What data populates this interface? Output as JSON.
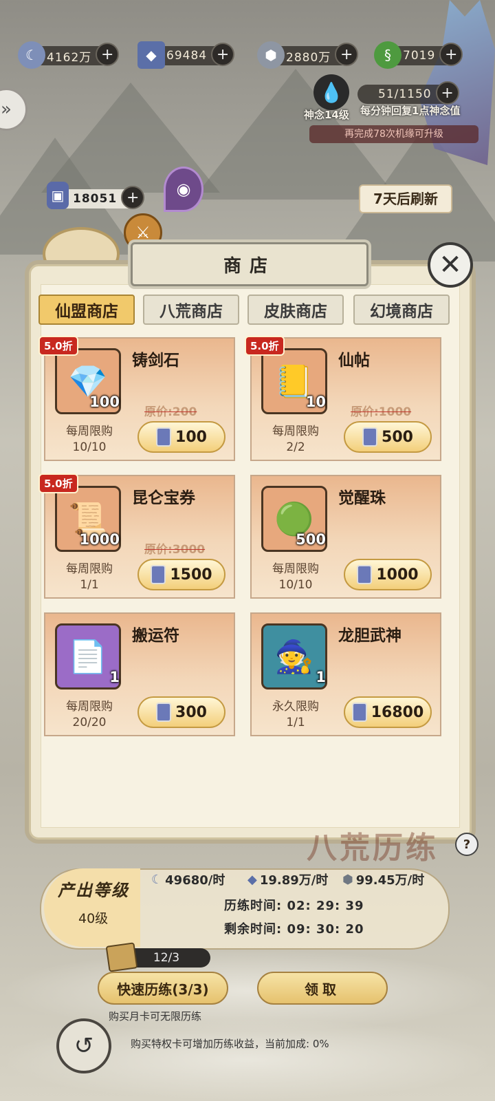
{
  "resources": [
    {
      "icon": "moon-stone-icon",
      "value": "4162万"
    },
    {
      "icon": "crystal-card-icon",
      "value": "69484"
    },
    {
      "icon": "ore-icon",
      "value": "2880万"
    },
    {
      "icon": "jade-dragon-icon",
      "value": "7019"
    }
  ],
  "spirit": {
    "value": "51/1150",
    "level": "神念14级",
    "regen": "每分钟回复1点神念值",
    "upgrade": "再完成78次机缘可升级"
  },
  "token_balance": "18051",
  "refresh_label": "7天后刷新",
  "shop": {
    "title": "商店",
    "tabs": [
      "仙盟商店",
      "八荒商店",
      "皮肤商店",
      "幻境商店"
    ],
    "items": [
      {
        "name": "铸剑石",
        "qty": "100",
        "discount": "5.0折",
        "orig": "原价:200",
        "limit": "每周限购",
        "count": "10/10",
        "price": "100",
        "thumb_bg": "#e7a87d",
        "glyph": "💎"
      },
      {
        "name": "仙帖",
        "qty": "10",
        "discount": "5.0折",
        "orig": "原价:1000",
        "limit": "每周限购",
        "count": "2/2",
        "price": "500",
        "thumb_bg": "#e7a87d",
        "glyph": "📒"
      },
      {
        "name": "昆仑宝券",
        "qty": "1000",
        "discount": "5.0折",
        "orig": "原价:3000",
        "limit": "每周限购",
        "count": "1/1",
        "price": "1500",
        "thumb_bg": "#e7a87d",
        "glyph": "📜"
      },
      {
        "name": "觉醒珠",
        "qty": "500",
        "discount": "",
        "orig": "",
        "limit": "每周限购",
        "count": "10/10",
        "price": "1000",
        "thumb_bg": "#e7a87d",
        "glyph": "🟢"
      },
      {
        "name": "搬运符",
        "qty": "1",
        "discount": "",
        "orig": "",
        "limit": "每周限购",
        "count": "20/20",
        "price": "300",
        "thumb_bg": "#9b6cc7",
        "glyph": "📄"
      },
      {
        "name": "龙胆武神",
        "qty": "1",
        "discount": "",
        "orig": "",
        "limit": "永久限购",
        "count": "1/1",
        "price": "16800",
        "thumb_bg": "#3f8fa0",
        "glyph": "🧙"
      }
    ]
  },
  "output": {
    "title": "产出等级",
    "level": "40级",
    "rates": [
      "49680/时",
      "19.89万/时",
      "99.45万/时"
    ],
    "train_time": "历练时间: 02: 29: 39",
    "remain_time": "剩余时间: 09: 30: 20"
  },
  "scroll_count": "12/3",
  "quick_btn": "快速历练(3/3)",
  "claim_btn": "领取",
  "monthly_note": "购买月卡可无限历练",
  "bonus_note": "购买特权卡可增加历练收益，当前加成: 0%",
  "bg_title": "八荒历练"
}
